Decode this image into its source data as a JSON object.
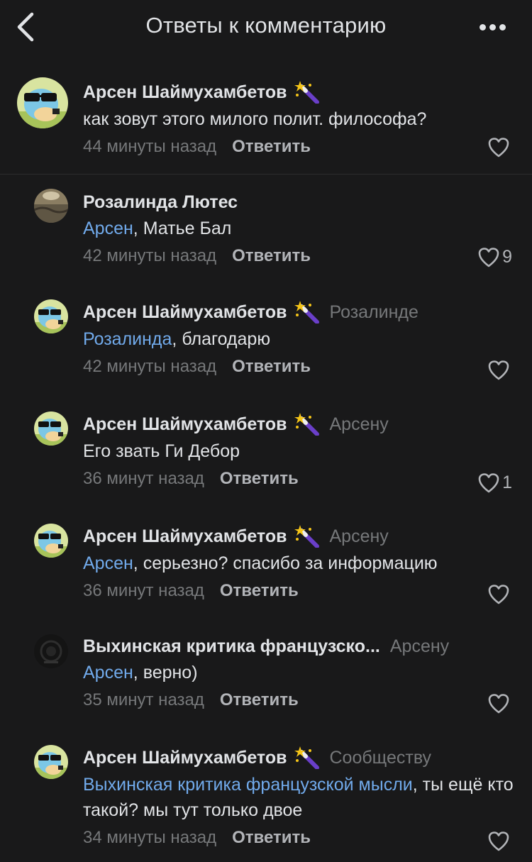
{
  "header": {
    "title": "Ответы к комментарию"
  },
  "main_comment": {
    "author": "Арсен Шаймухамбетов",
    "text": "как зовут этого милого полит. философа?",
    "time": "44 минуты назад",
    "reply_label": "Ответить",
    "likes": ""
  },
  "replies": [
    {
      "author": "Розалинда Лютес",
      "reply_to": "",
      "mention": "Арсен",
      "text": ", Матье Бал",
      "time": "42 минуты назад",
      "reply_label": "Ответить",
      "likes": "9"
    },
    {
      "author": "Арсен Шаймухамбетов",
      "reply_to": "Розалинде",
      "mention": "Розалинда",
      "text": ", благодарю",
      "time": "42 минуты назад",
      "reply_label": "Ответить",
      "likes": ""
    },
    {
      "author": "Арсен Шаймухамбетов",
      "reply_to": "Арсену",
      "mention": "",
      "text": "Его звать Ги Дебор",
      "time": "36 минут назад",
      "reply_label": "Ответить",
      "likes": "1"
    },
    {
      "author": "Арсен Шаймухамбетов",
      "reply_to": "Арсену",
      "mention": "Арсен",
      "text": ", серьезно? спасибо за информацию",
      "time": "36 минут назад",
      "reply_label": "Ответить",
      "likes": ""
    },
    {
      "author": "Выхинская критика французско...",
      "reply_to": "Арсену",
      "mention": "Арсен",
      "text": ", верно)",
      "time": "35 минут назад",
      "reply_label": "Ответить",
      "likes": ""
    },
    {
      "author": "Арсен Шаймухамбетов",
      "reply_to": "Сообществу",
      "mention": "Выхинская критика французской мысли",
      "text": ", ты ещё кто такой? мы тут только двое",
      "time": "34 минуты назад",
      "reply_label": "Ответить",
      "likes": ""
    }
  ],
  "colors": {
    "background": "#19191a",
    "text": "#e1e3e6",
    "secondary": "#76787a",
    "link": "#71aaeb"
  }
}
